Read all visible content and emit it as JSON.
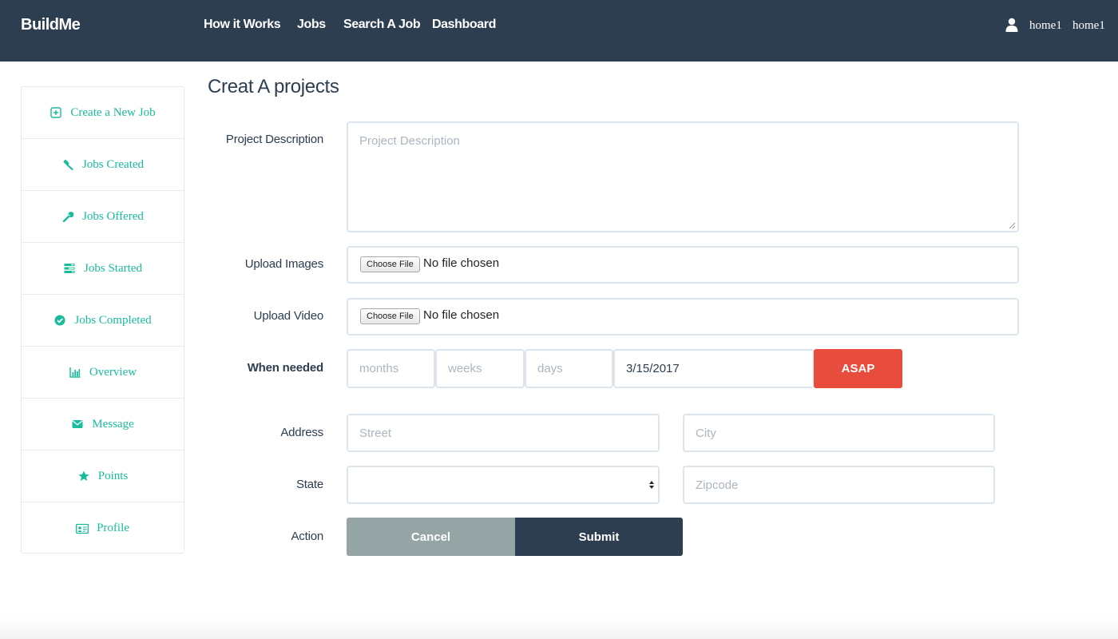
{
  "navbar": {
    "brand": "BuildMe",
    "links": [
      "How it Works",
      "Jobs",
      "Search A Job",
      "Dashboard"
    ],
    "user_icon": "user-icon",
    "user_names": [
      "home1",
      "home1"
    ],
    "bg_color": "#2c3e50"
  },
  "sidebar": {
    "items": [
      {
        "label": "Create a New Job",
        "icon": "plus-square-icon"
      },
      {
        "label": "Jobs Created",
        "icon": "gavel-icon"
      },
      {
        "label": "Jobs Offered",
        "icon": "wrench-icon"
      },
      {
        "label": "Jobs Started",
        "icon": "tasks-icon"
      },
      {
        "label": "Jobs Completed",
        "icon": "check-circle-icon"
      },
      {
        "label": "Overview",
        "icon": "bar-chart-icon"
      },
      {
        "label": "Message",
        "icon": "envelope-icon"
      },
      {
        "label": "Points",
        "icon": "star-icon"
      },
      {
        "label": "Profile",
        "icon": "id-card-icon"
      }
    ],
    "accent_color": "#18bc9c"
  },
  "form": {
    "title": "Creat A projects",
    "project_description": {
      "label": "Project Description",
      "placeholder": "Project Description",
      "value": ""
    },
    "upload_images": {
      "label": "Upload Images",
      "button": "Choose File",
      "status": "No file chosen"
    },
    "upload_video": {
      "label": "Upload Video",
      "button": "Choose File",
      "status": "No file chosen"
    },
    "when_needed": {
      "label": "When needed",
      "months_placeholder": "months",
      "weeks_placeholder": "weeks",
      "days_placeholder": "days",
      "date_value": "3/15/2017",
      "asap_button": "ASAP"
    },
    "address": {
      "label": "Address",
      "street_placeholder": "Street",
      "city_placeholder": "City"
    },
    "state": {
      "label": "State",
      "selected": "",
      "zipcode_placeholder": "Zipcode"
    },
    "action": {
      "label": "Action",
      "cancel": "Cancel",
      "submit": "Submit"
    },
    "colors": {
      "asap": "#e74c3c",
      "cancel": "#95a5a6",
      "submit": "#2c3e50"
    }
  }
}
